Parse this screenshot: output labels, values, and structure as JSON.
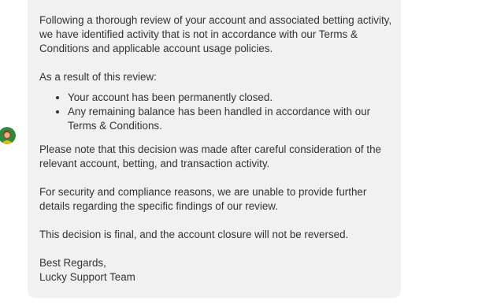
{
  "message": {
    "paragraph_1": "Following a thorough review of your account and associated betting activity, we have identified activity that is not in accordance with our Terms & Conditions and applicable account usage policies.",
    "paragraph_2": "As a result of this review:",
    "bullets": [
      "Your account has been permanently closed.",
      "Any remaining balance has been handled in accordance with our Terms & Conditions."
    ],
    "paragraph_3": "Please note that this decision was made after careful consideration of the relevant account, betting, and transaction activity.",
    "paragraph_4": "For security and compliance reasons, we are unable to provide further details regarding the specific findings of our review.",
    "paragraph_5": "This decision is final, and the account closure will not be reversed.",
    "signoff": "Best Regards,",
    "signature": "Lucky Support Team"
  },
  "colors": {
    "bubble_background": "#f1f1f2",
    "text": "#333333"
  },
  "icons": {
    "avatar": "support-agent-avatar-icon"
  }
}
